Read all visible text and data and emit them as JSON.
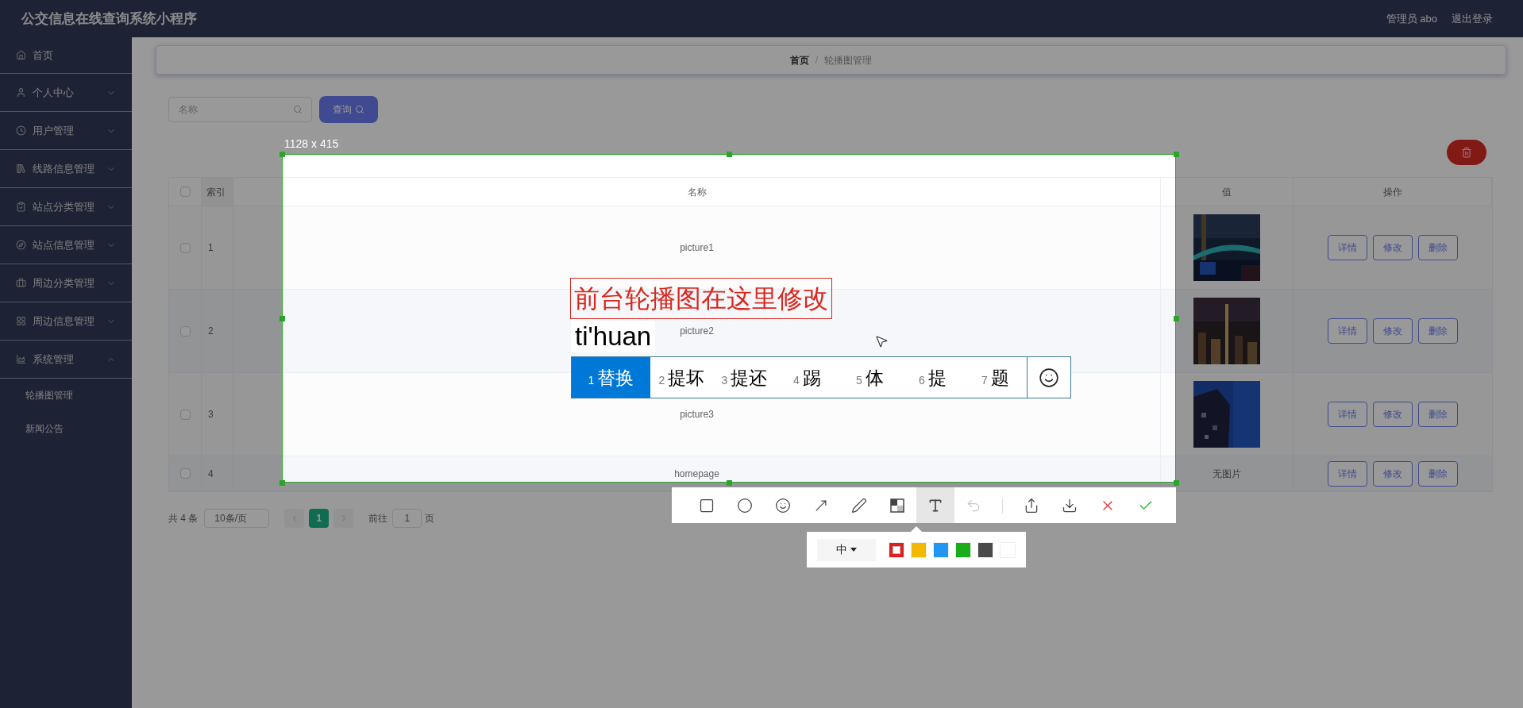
{
  "header": {
    "title": "公交信息在线查询系统小程序",
    "user": "管理员 abo",
    "logout": "退出登录"
  },
  "sidebar": {
    "items": [
      {
        "label": "首页",
        "kind": "link"
      },
      {
        "label": "个人中心",
        "kind": "menu",
        "expanded": false
      },
      {
        "label": "用户管理",
        "kind": "menu",
        "expanded": false
      },
      {
        "label": "线路信息管理",
        "kind": "menu",
        "expanded": false
      },
      {
        "label": "站点分类管理",
        "kind": "menu",
        "expanded": false
      },
      {
        "label": "站点信息管理",
        "kind": "menu",
        "expanded": false
      },
      {
        "label": "周边分类管理",
        "kind": "menu",
        "expanded": false
      },
      {
        "label": "周边信息管理",
        "kind": "menu",
        "expanded": false
      },
      {
        "label": "系统管理",
        "kind": "menu",
        "expanded": true,
        "children": [
          {
            "label": "轮播图管理"
          },
          {
            "label": "新闻公告"
          }
        ]
      }
    ]
  },
  "breadcrumb": {
    "items": [
      "首页",
      "轮播图管理"
    ],
    "separator": "/"
  },
  "search": {
    "placeholder": "名称",
    "button": "查询"
  },
  "table": {
    "select_all_checked": false,
    "columns": [
      "索引",
      "名称",
      "值",
      "操作"
    ],
    "rows": [
      {
        "checked": false,
        "index": "1",
        "name": "picture1",
        "value": {
          "kind": "picture"
        },
        "actions": [
          "详情",
          "修改",
          "删除"
        ]
      },
      {
        "checked": false,
        "index": "2",
        "name": "picture2",
        "value": {
          "kind": "picture"
        },
        "actions": [
          "详情",
          "修改",
          "删除"
        ]
      },
      {
        "checked": false,
        "index": "3",
        "name": "picture3",
        "value": {
          "kind": "picture"
        },
        "actions": [
          "详情",
          "修改",
          "删除"
        ]
      },
      {
        "checked": false,
        "index": "4",
        "name": "homepage",
        "value": {
          "kind": "text",
          "text": "无图片"
        },
        "actions": [
          "详情",
          "修改",
          "删除"
        ]
      }
    ]
  },
  "pagination": {
    "total": "共 4 条",
    "page_size": "10条/页",
    "pages": [
      {
        "label": "1",
        "selected": true
      }
    ],
    "goto_label": "前往",
    "goto_value": "1",
    "goto_suffix": "页"
  },
  "screenshot_tool": {
    "size_label": "1128 x 415",
    "annotation": {
      "text": "前台轮播图在这里修改",
      "color": "#d9271e"
    },
    "tools": [
      {
        "kind": "rectangle",
        "selected": false,
        "disabled": false
      },
      {
        "kind": "ellipse",
        "selected": false,
        "disabled": false
      },
      {
        "kind": "emoji",
        "selected": false,
        "disabled": false
      },
      {
        "kind": "arrow",
        "selected": false,
        "disabled": false
      },
      {
        "kind": "pen",
        "selected": false,
        "disabled": false
      },
      {
        "kind": "mosaic",
        "selected": false,
        "disabled": false
      },
      {
        "kind": "text",
        "selected": true,
        "disabled": false
      },
      {
        "kind": "undo",
        "selected": false,
        "disabled": true
      },
      {
        "kind": "share",
        "selected": false,
        "disabled": false
      },
      {
        "kind": "download",
        "selected": false,
        "disabled": false
      },
      {
        "kind": "cancel",
        "selected": false,
        "disabled": false
      },
      {
        "kind": "confirm",
        "selected": false,
        "disabled": false
      }
    ],
    "font_size": "中",
    "colors": [
      {
        "color": "#e02020",
        "selected": true
      },
      {
        "color": "#f5b800",
        "selected": false
      },
      {
        "color": "#2196f3",
        "selected": false
      },
      {
        "color": "#1aad19",
        "selected": false
      },
      {
        "color": "#4a4a4a",
        "selected": false
      },
      {
        "color": "#ffffff",
        "selected": false
      }
    ]
  },
  "ime": {
    "composition": "ti'huan",
    "candidates": [
      {
        "number": "1",
        "text": "替换",
        "selected": true
      },
      {
        "number": "2",
        "text": "提坏",
        "selected": false
      },
      {
        "number": "3",
        "text": "提还",
        "selected": false
      },
      {
        "number": "4",
        "text": "踢",
        "selected": false
      },
      {
        "number": "5",
        "text": "体",
        "selected": false
      },
      {
        "number": "6",
        "text": "提",
        "selected": false
      },
      {
        "number": "7",
        "text": "题",
        "selected": false
      }
    ]
  }
}
